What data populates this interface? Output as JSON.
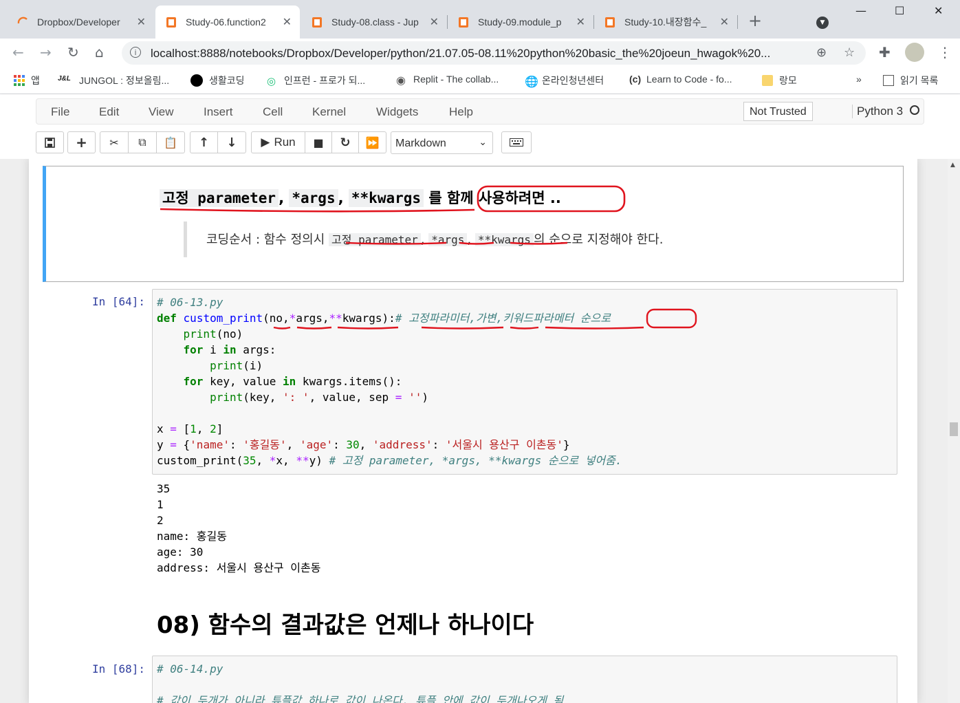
{
  "browser": {
    "tabs": [
      {
        "title": "Dropbox/Developer",
        "active": false
      },
      {
        "title": "Study-06.function2",
        "active": true
      },
      {
        "title": "Study-08.class - Jup",
        "active": false
      },
      {
        "title": "Study-09.module_p",
        "active": false
      },
      {
        "title": "Study-10.내장함수_",
        "active": false
      }
    ],
    "url": "localhost:8888/notebooks/Dropbox/Developer/python/21.07.05-08.11%20python%20basic_the%20joeun_hwagok%20...",
    "bookmarks": [
      {
        "label": "앱"
      },
      {
        "label": "JUNGOL : 정보올림..."
      },
      {
        "label": "생활코딩"
      },
      {
        "label": "인프런 - 프로가 되..."
      },
      {
        "label": "Replit - The collab..."
      },
      {
        "label": "온라인청년센터"
      },
      {
        "label": "Learn to Code - fo..."
      },
      {
        "label": "랑모"
      }
    ],
    "more": "»",
    "reading_list": "읽기 목록"
  },
  "jupyter": {
    "menu": [
      "File",
      "Edit",
      "View",
      "Insert",
      "Cell",
      "Kernel",
      "Widgets",
      "Help"
    ],
    "not_trusted": "Not Trusted",
    "kernel": "Python 3",
    "run_label": "Run",
    "cell_type": "Markdown"
  },
  "notebook": {
    "md_heading": {
      "code1": "고정 parameter",
      "sep1": ",",
      "code2": "*args",
      "sep2": ",",
      "code3": "**kwargs",
      "text": "를 함께 사용하려면 .."
    },
    "md_quote": {
      "prefix": "코딩순서 : 함수 정의시",
      "code1": "고정 parameter",
      "code2": "*args",
      "code3": "**kwargs",
      "suffix": "의 순으로 지정해야 한다."
    },
    "cell64": {
      "prompt": "In [64]:",
      "comment_line1": "# 06-13.py",
      "def_comment": "# 고정파라미터,가변,키워드파라메터 순으로",
      "call_comment": "# 고정 parameter, *args, **kwargs 순으로 넣어줌.",
      "dict_name": "'홍길동'",
      "dict_address": "'서울시 용산구 이촌동'",
      "output": [
        "35",
        "1",
        "2",
        "name: 홍길동",
        "age: 30",
        "address: 서울시 용산구 이촌동"
      ]
    },
    "h2": "08) 함수의 결과값은 언제나 하나이다",
    "cell68": {
      "prompt": "In [68]:",
      "line1": "# 06-14.py",
      "line2": "# 값이 두개가 아니라 튜플값 하나로 값이 나온다. 튜플 안에 값이 두개나오게 됨"
    }
  },
  "colors": {
    "accent_blue": "#42a5f5",
    "annotation_red": "#e0141e",
    "prompt_blue": "#303f9f"
  }
}
